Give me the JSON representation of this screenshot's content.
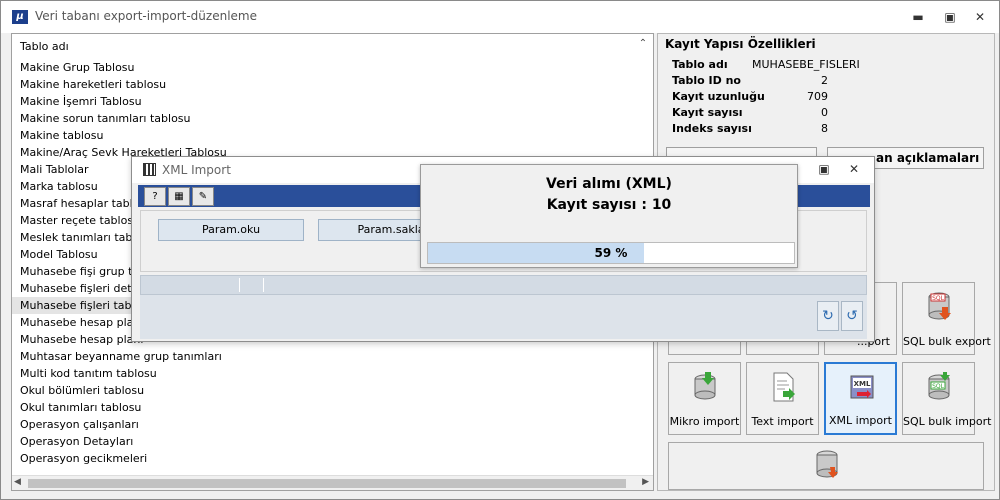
{
  "window": {
    "title": "Veri tabanı export-import-düzenleme"
  },
  "table_list": {
    "header": "Tablo adı",
    "rows": [
      "Makine Grup Tablosu",
      "Makine hareketleri tablosu",
      "Makine İşemri Tablosu",
      "Makine sorun tanımları tablosu",
      "Makine tablosu",
      "Makine/Araç Sevk Hareketleri Tablosu",
      "Mali Tablolar",
      "Marka tablosu",
      "Masraf hesaplar tablosu",
      "Master reçete tablosu",
      "Meslek tanımları tablosu",
      "Model Tablosu",
      "Muhasebe fişi grup tablosu",
      "Muhasebe fişleri detay",
      "Muhasebe fişleri tablosu",
      "Muhasebe hesap planı",
      "Muhasebe hesap planı",
      "Muhtasar beyanname grup tanımları",
      "Multi kod tanıtım tablosu",
      "Okul bölümleri tablosu",
      "Okul tanımları tablosu",
      "Operasyon çalışanları",
      "Operasyon Detayları",
      "Operasyon gecikmeleri"
    ],
    "selected_index": 14
  },
  "record_props": {
    "title": "Kayıt Yapısı Özellikleri",
    "table_name_label": "Tablo adı",
    "table_name_value": "MUHASEBE_FISLERI",
    "table_id_label": "Tablo ID no",
    "table_id_value": "2",
    "record_length_label": "Kayıt uzunluğu",
    "record_length_value": "709",
    "record_count_label": "Kayıt sayısı",
    "record_count_value": "0",
    "index_count_label": "Indeks sayısı",
    "index_count_value": "8",
    "desc_button": "an açıklamaları"
  },
  "tiles": {
    "row1": [
      "...port",
      "SQL bulk export"
    ],
    "row2": [
      "Mikro import",
      "Text import",
      "XML import",
      "SQL bulk import"
    ]
  },
  "xml_dialog": {
    "title": "XML Import",
    "btn_read": "Param.oku",
    "btn_save": "Param.sakla"
  },
  "progress": {
    "line1": "Veri alımı (XML)",
    "line2": "Kayıt sayısı : 10",
    "percent_label": "59 %",
    "fraction": 0.59
  }
}
